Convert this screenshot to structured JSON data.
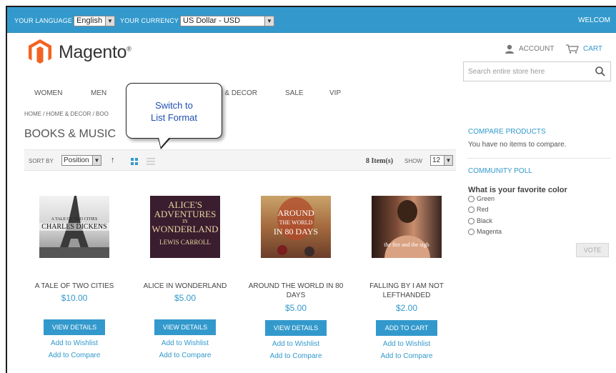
{
  "topbar": {
    "language_label": "YOUR LANGUAGE",
    "language_value": "English",
    "currency_label": "YOUR CURRENCY",
    "currency_value": "US Dollar - USD",
    "welcome": "WELCOM"
  },
  "header": {
    "logo_text": "Magento",
    "logo_mark": "®",
    "account": "ACCOUNT",
    "cart": "CART",
    "search_placeholder": "Search entire store here"
  },
  "nav": {
    "items": [
      "WOMEN",
      "MEN",
      "E & DECOR",
      "SALE",
      "VIP"
    ]
  },
  "breadcrumb": "HOME / HOME & DECOR / BOO",
  "page_title": "BOOKS & MUSIC",
  "tooltip": {
    "line1": "Switch to",
    "line2": "List Format"
  },
  "toolbar": {
    "sort_label": "SORT BY",
    "sort_value": "Position",
    "sort_dir": "↑",
    "item_count": "8 Item(s)",
    "show_label": "SHOW",
    "show_value": "12"
  },
  "products": [
    {
      "name_line1": "A TALE OF TWO CITIES",
      "name_line2": "",
      "price": "$10.00",
      "button": "VIEW DETAILS",
      "wishlist": "Add to Wishlist",
      "compare": "Add to Compare",
      "cover_title": "CHARLES DICKENS",
      "cover_subtitle": "A TALE OF TWO CITIES"
    },
    {
      "name_line1": "ALICE IN WONDERLAND",
      "name_line2": "",
      "price": "$5.00",
      "button": "VIEW DETAILS",
      "wishlist": "Add to Wishlist",
      "compare": "Add to Compare",
      "cover_lines": [
        "ALICE'S",
        "ADVENTURES",
        "IN",
        "WONDERLAND",
        "LEWIS CARROLL"
      ]
    },
    {
      "name_line1": "AROUND THE WORLD IN 80",
      "name_line2": "DAYS",
      "price": "$5.00",
      "button": "VIEW DETAILS",
      "wishlist": "Add to Wishlist",
      "compare": "Add to Compare",
      "cover_lines": [
        "AROUND",
        "THE WORLD",
        "IN 80 DAYS"
      ]
    },
    {
      "name_line1": "FALLING BY I AM NOT",
      "name_line2": "LEFTHANDED",
      "price": "$2.00",
      "button": "ADD TO CART",
      "wishlist": "Add to Wishlist",
      "compare": "Add to Compare",
      "cover_title": "the fire and the sigh"
    }
  ],
  "sidebar": {
    "compare_heading": "COMPARE PRODUCTS",
    "compare_text": "You have no items to compare.",
    "poll_heading": "COMMUNITY POLL",
    "poll_question": "What is your favorite color",
    "poll_options": [
      "Green",
      "Red",
      "Black",
      "Magenta"
    ],
    "vote_button": "VOTE"
  },
  "colors": {
    "accent": "#3399cc",
    "logo_orange": "#f26322"
  }
}
